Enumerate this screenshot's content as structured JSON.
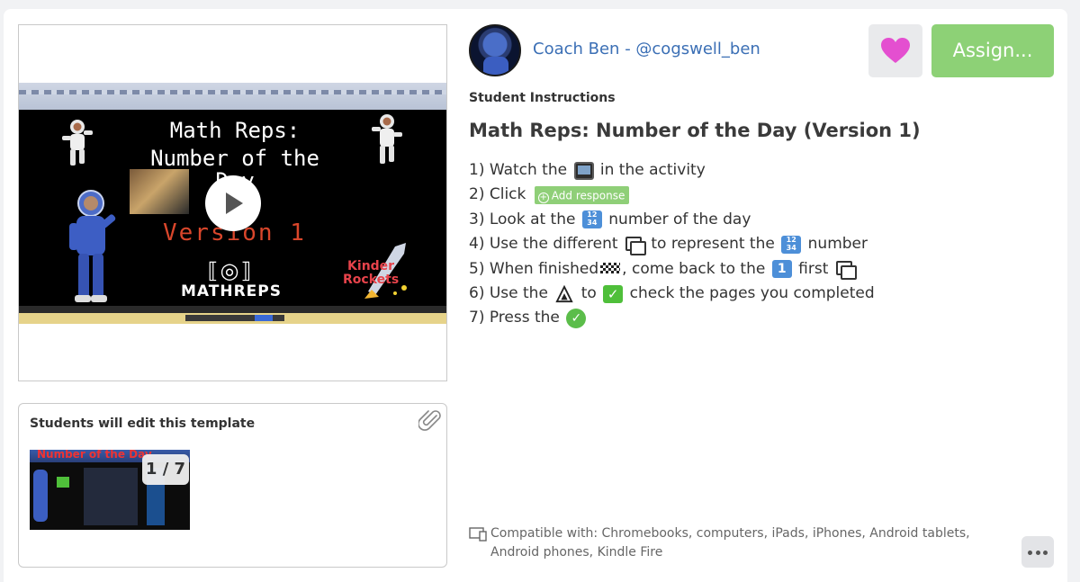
{
  "video": {
    "title_line1": "Math Reps:",
    "title_line2": "Number of the",
    "title_line3": "Day",
    "version_text": "Version 1",
    "logo_mark": "⟦◎⟧",
    "logo_word": "MATHREPS",
    "rockets_text": "Kinder\nRockets",
    "play_icon": "play-icon"
  },
  "template": {
    "heading": "Students will edit this template",
    "page_indicator": "1 / 7",
    "thumb_title": "Number of the Day",
    "attach_icon": "paperclip-icon"
  },
  "author": {
    "name": "Coach Ben - @cogswell_ben"
  },
  "actions": {
    "like_icon": "heart-icon",
    "like_color": "#e44fd0",
    "assign_label": "Assign...",
    "assign_color": "#8dd176"
  },
  "instructions": {
    "section_label": "Student Instructions",
    "title": "Math Reps: Number of the Day (Version 1)",
    "add_response_label": "Add response",
    "steps": {
      "s1a": "1) Watch the",
      "s1b": "in the activity",
      "s2a": "2) Click",
      "s3a": "3) Look at the",
      "s3b": "number of the day",
      "s4a": "4) Use the different",
      "s4b": "to represent the",
      "s4c": "number",
      "s5a": "5) When finished",
      "s5b": ", come back to the",
      "s5c": "first",
      "s6a": "6) Use the",
      "s6b": "to",
      "s6c": "check the pages you completed",
      "s7a": "7) Press the"
    }
  },
  "compatibility": {
    "text": "Compatible with: Chromebooks, computers, iPads, iPhones, Android tablets, Android phones, Kindle Fire"
  },
  "more_icon": "more-dots-icon"
}
